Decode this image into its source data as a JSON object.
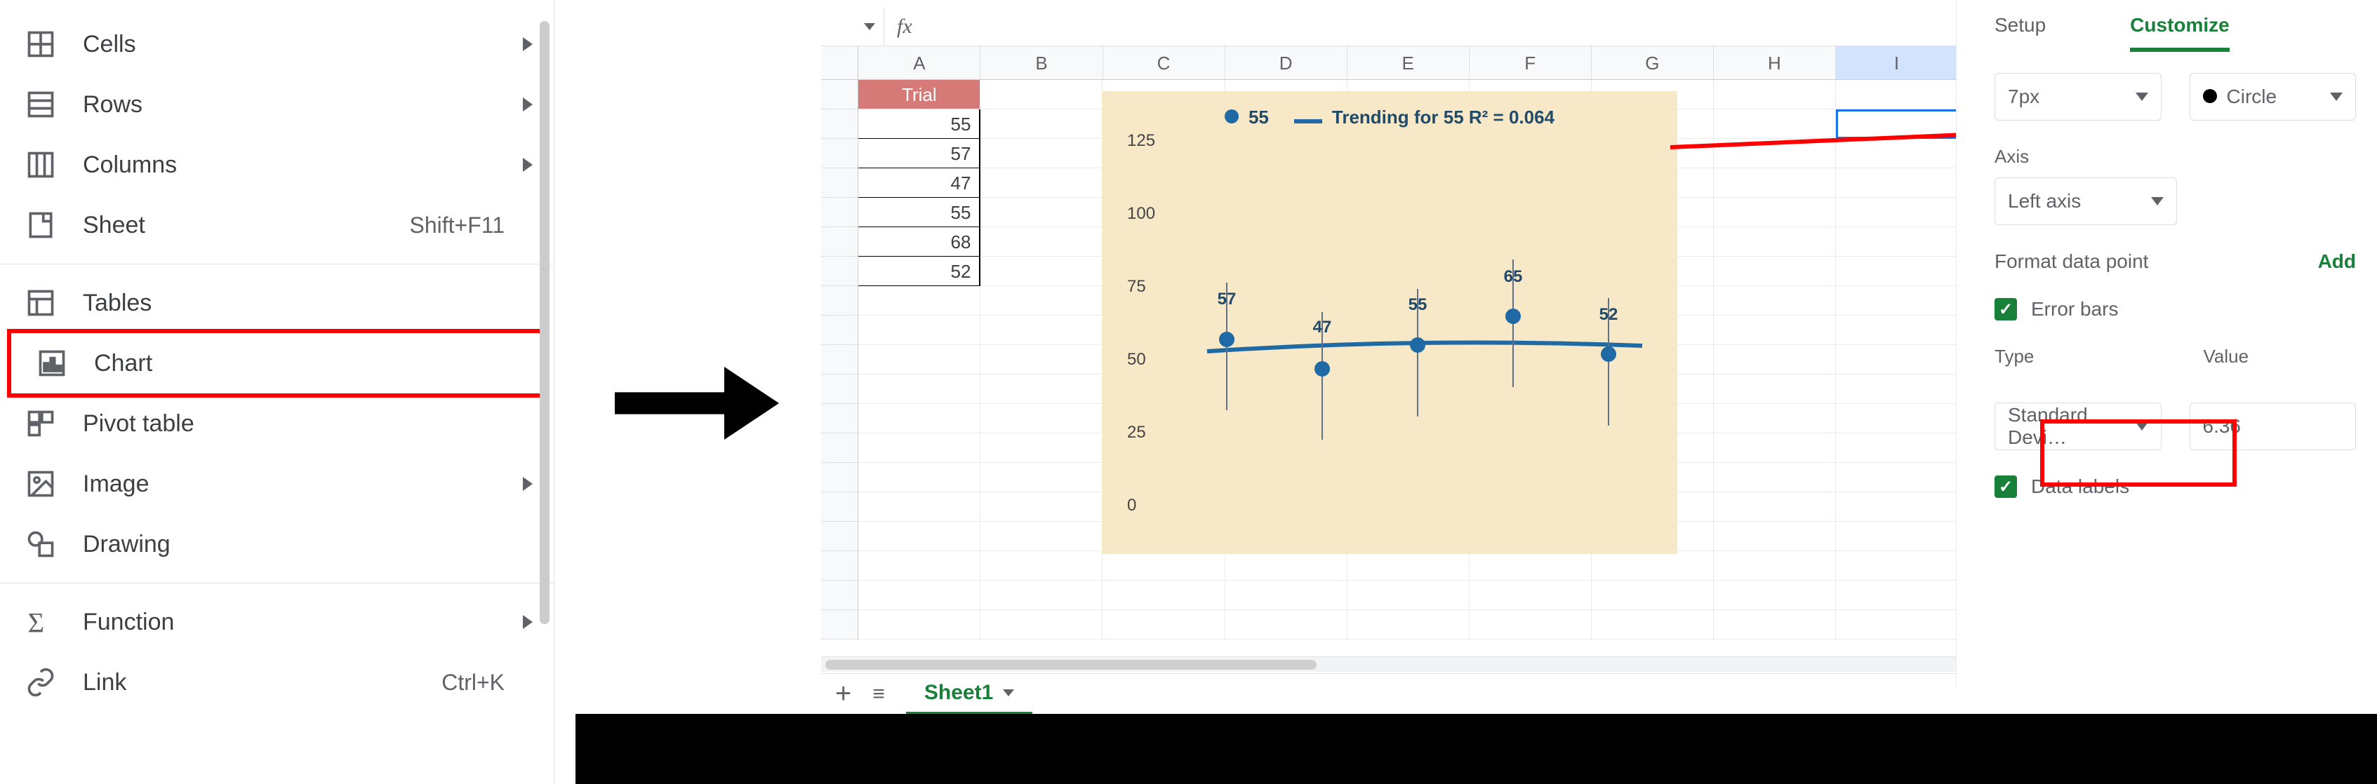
{
  "menu": {
    "items": [
      {
        "label": "Cells",
        "shortcut": "",
        "arrow": true
      },
      {
        "label": "Rows",
        "shortcut": "",
        "arrow": true
      },
      {
        "label": "Columns",
        "shortcut": "",
        "arrow": true
      },
      {
        "label": "Sheet",
        "shortcut": "Shift+F11",
        "arrow": false
      }
    ],
    "items2": [
      {
        "label": "Tables"
      },
      {
        "label": "Chart",
        "highlight": true
      },
      {
        "label": "Pivot table"
      },
      {
        "label": "Image",
        "arrow": true
      },
      {
        "label": "Drawing"
      }
    ],
    "items3": [
      {
        "label": "Function",
        "arrow": true
      },
      {
        "label": "Link",
        "shortcut": "Ctrl+K"
      }
    ]
  },
  "spreadsheet": {
    "fx": "fx",
    "columns": [
      "A",
      "B",
      "C",
      "D",
      "E",
      "F",
      "G",
      "H",
      "I"
    ],
    "active_col": "I",
    "header_cell": "Trial",
    "data_col": [
      55,
      57,
      47,
      55,
      68,
      52
    ],
    "sheet_tab": "Sheet1"
  },
  "chart_data": {
    "type": "scatter",
    "legend_series": "55",
    "legend_trend": "Trending for 55 R² = 0.064",
    "ylim": [
      0,
      125
    ],
    "yticks": [
      0,
      25,
      50,
      75,
      100,
      125
    ],
    "x": [
      1,
      2,
      3,
      4,
      5
    ],
    "values": [
      57,
      47,
      55,
      65,
      52
    ],
    "labels": [
      "57",
      "47",
      "55",
      "65",
      "52"
    ],
    "error_value": 6.36,
    "background": "#f7e9c8",
    "point_color": "#1f6aa5",
    "trendline_color": "#1f6aa5"
  },
  "editor": {
    "tab_setup": "Setup",
    "tab_customize": "Customize",
    "point_size": "7px",
    "point_shape": "Circle",
    "axis_section": "Axis",
    "axis_value": "Left axis",
    "format_data_point": "Format data point",
    "add": "Add",
    "error_bars": "Error bars",
    "type_label": "Type",
    "type_value": "Standard Devi…",
    "value_label": "Value",
    "value_value": "6.36",
    "data_labels": "Data labels"
  }
}
